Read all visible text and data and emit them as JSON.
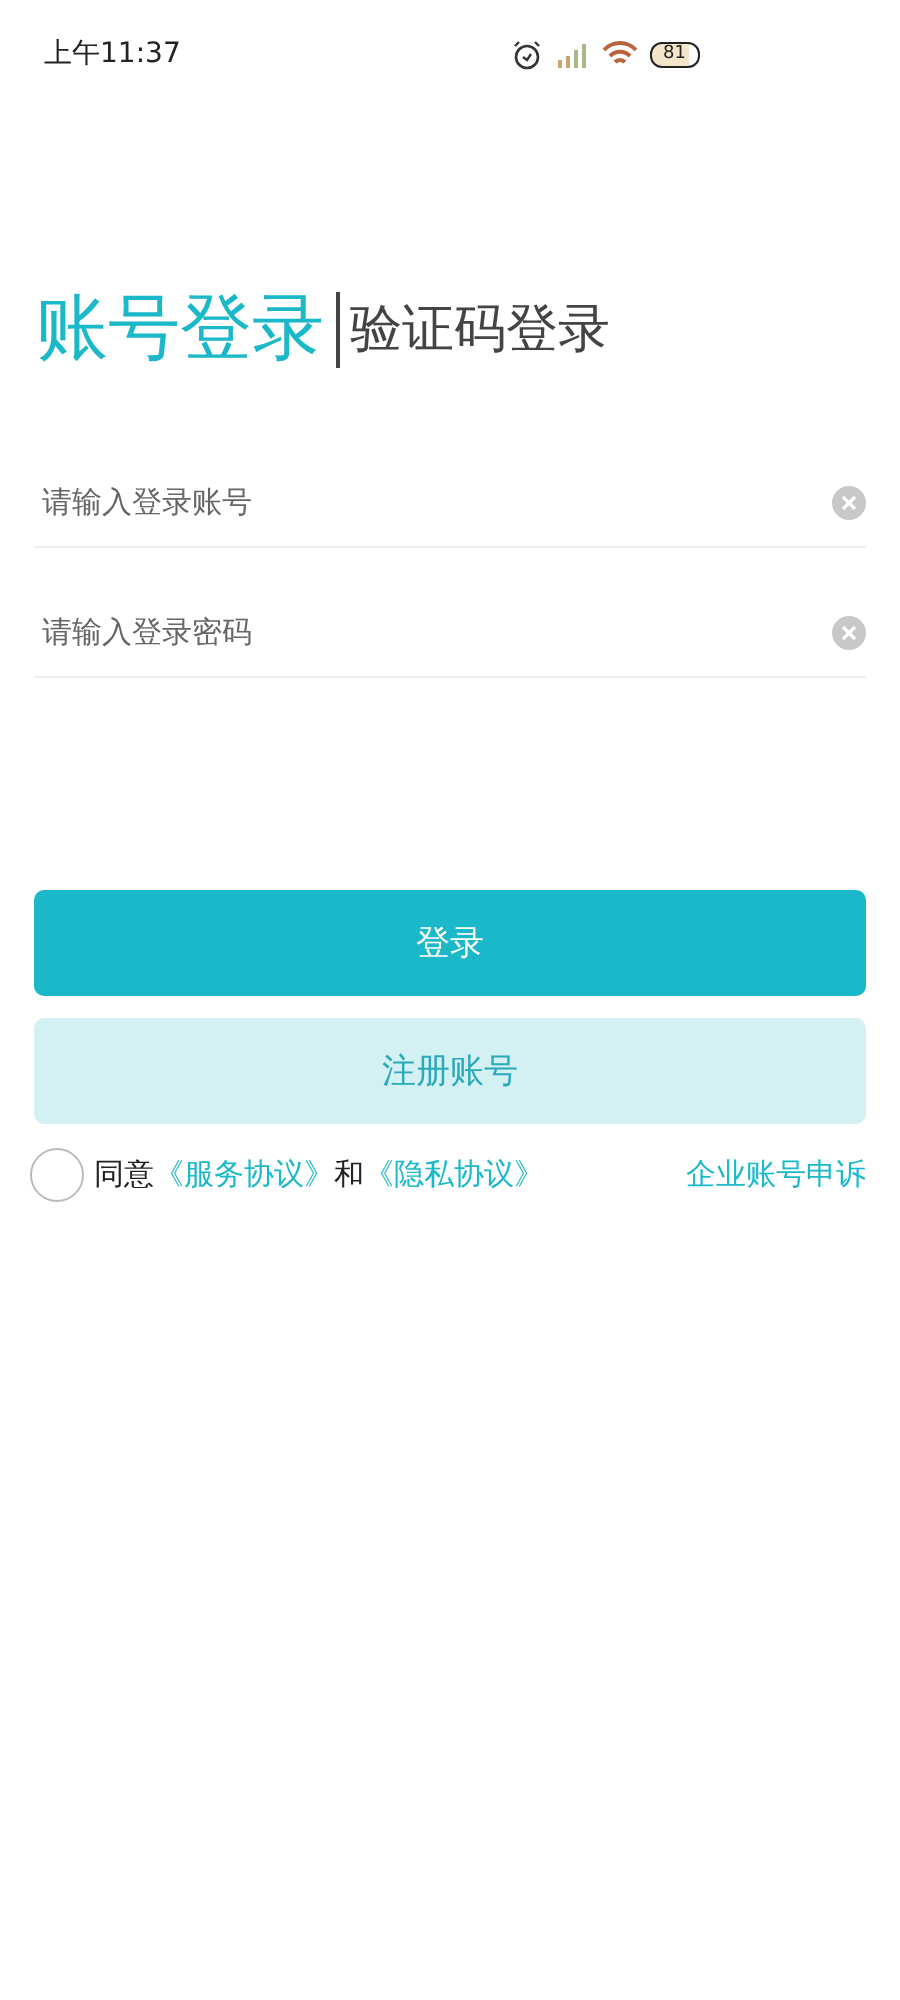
{
  "status_bar": {
    "time": "上午11:37",
    "battery": "81"
  },
  "tabs": [
    {
      "label": "账号登录",
      "selected": true
    },
    {
      "label": "验证码登录",
      "selected": false
    }
  ],
  "fields": [
    {
      "placeholder": "请输入登录账号"
    },
    {
      "placeholder": "请输入登录密码"
    }
  ],
  "buttons": [
    {
      "label": "登录",
      "kind": "primary"
    },
    {
      "label": "注册账号",
      "kind": "secondary"
    }
  ],
  "agreement": {
    "checked": false,
    "parts": [
      {
        "kind": "text",
        "text": "同意"
      },
      {
        "kind": "link",
        "text": "《服务协议》"
      },
      {
        "kind": "text",
        "text": "和"
      },
      {
        "kind": "link",
        "text": "《隐私协议》"
      }
    ]
  },
  "appeal_link": "企业账号申诉"
}
